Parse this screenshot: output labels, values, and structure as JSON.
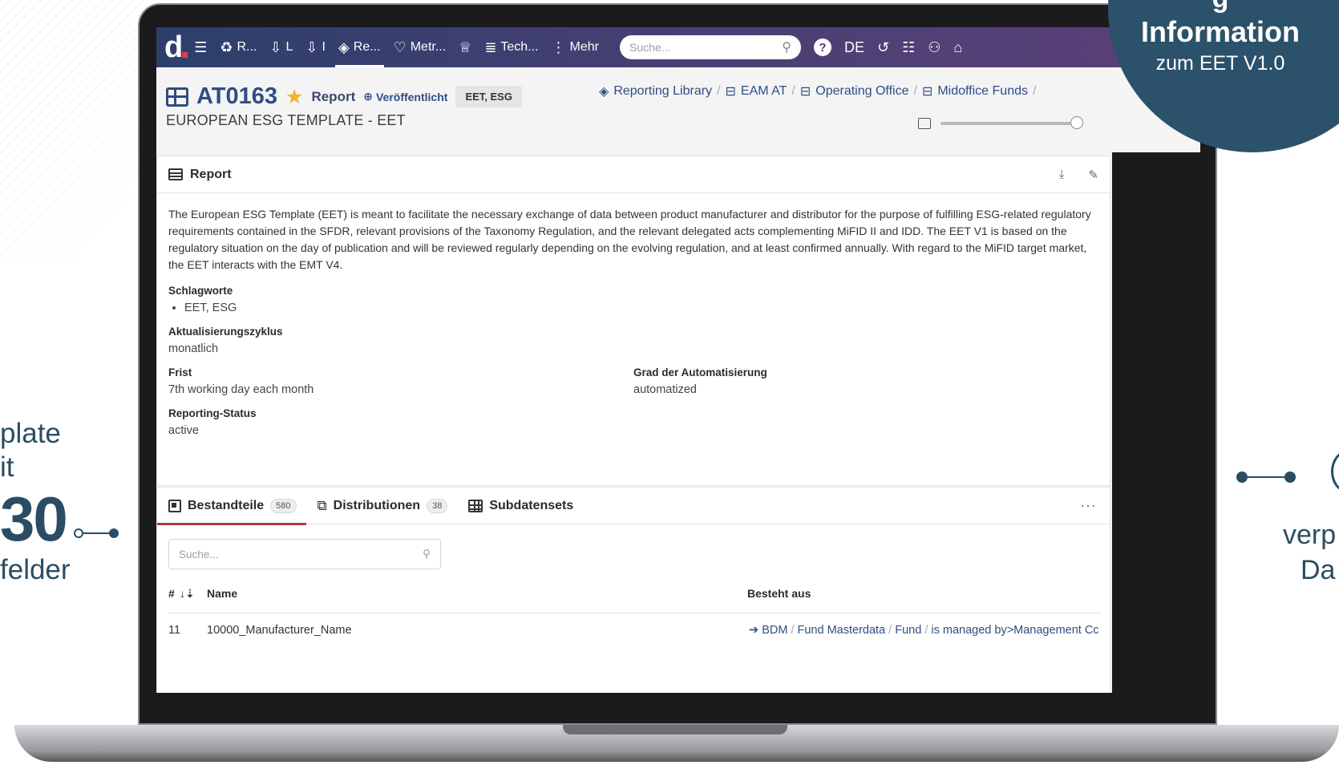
{
  "left_note": {
    "line1": "plate",
    "line2": "it",
    "big": "30",
    "line3": "felder"
  },
  "right_note": {
    "line1": "verp",
    "line2": "Da"
  },
  "badge": {
    "line1": "g",
    "line2": "Information",
    "line3": "zum EET V1.0"
  },
  "topnav": {
    "logo": "d",
    "items": [
      {
        "icon": "database-icon",
        "glyph": "⛁",
        "label": ""
      },
      {
        "icon": "recycle-icon",
        "glyph": "♻",
        "label": "R..."
      },
      {
        "icon": "hand-icon",
        "glyph": "✋",
        "label": "L"
      },
      {
        "icon": "hand-up-icon",
        "glyph": "✋",
        "label": "I"
      },
      {
        "icon": "gem-icon",
        "glyph": "♦",
        "label": "Re..."
      },
      {
        "icon": "heart-pulse-icon",
        "glyph": "♡",
        "label": "Metr..."
      },
      {
        "icon": "trophy-icon",
        "glyph": "🏆",
        "label": ""
      },
      {
        "icon": "stack-icon",
        "glyph": "⛁",
        "label": "Tech..."
      },
      {
        "icon": "kebab-icon",
        "glyph": "⋮",
        "label": "Mehr"
      }
    ],
    "search_placeholder": "Suche...",
    "language": "DE"
  },
  "header": {
    "code": "AT0163",
    "type": "Report",
    "status": "Veröffentlicht",
    "tags": "EET, ESG",
    "subtitle": "EUROPEAN ESG TEMPLATE - EET",
    "breadcrumb": [
      "Reporting Library",
      "EAM AT",
      "Operating Office",
      "Midoffice Funds"
    ]
  },
  "report": {
    "title": "Report",
    "description": "The European ESG Template (EET) is meant to facilitate the necessary exchange of data between product manufacturer and distributor for the purpose of fulfilling ESG-related regulatory requirements contained in the SFDR, relevant provisions of the Taxonomy Regulation, and the relevant delegated acts complementing MiFID II and IDD. The EET V1 is based on the regulatory situation on the day of publication and will be reviewed regularly depending on the evolving regulation, and at least confirmed annually. With regard to the MiFID target market, the EET interacts with the EMT V4.",
    "keywords_label": "Schlagworte",
    "keywords_value": "EET, ESG",
    "cycle_label": "Aktualisierungszyklus",
    "cycle_value": "monatlich",
    "deadline_label": "Frist",
    "deadline_value": "7th working day each month",
    "automation_label": "Grad der Automatisierung",
    "automation_value": "automatized",
    "status_label": "Reporting-Status",
    "status_value": "active"
  },
  "tabs": {
    "items": [
      {
        "label": "Bestandteile",
        "count": "580"
      },
      {
        "label": "Distributionen",
        "count": "38"
      },
      {
        "label": "Subdatensets",
        "count": ""
      }
    ],
    "search_placeholder": "Suche...",
    "columns": {
      "num": "#",
      "sort": "↓⇣",
      "name": "Name",
      "consists": "Besteht aus"
    },
    "rows": [
      {
        "num": "11",
        "name": "10000_Manufacturer_Name",
        "path": [
          "BDM",
          "Fund Masterdata",
          "Fund",
          "is managed by>Management Cc"
        ]
      }
    ]
  }
}
